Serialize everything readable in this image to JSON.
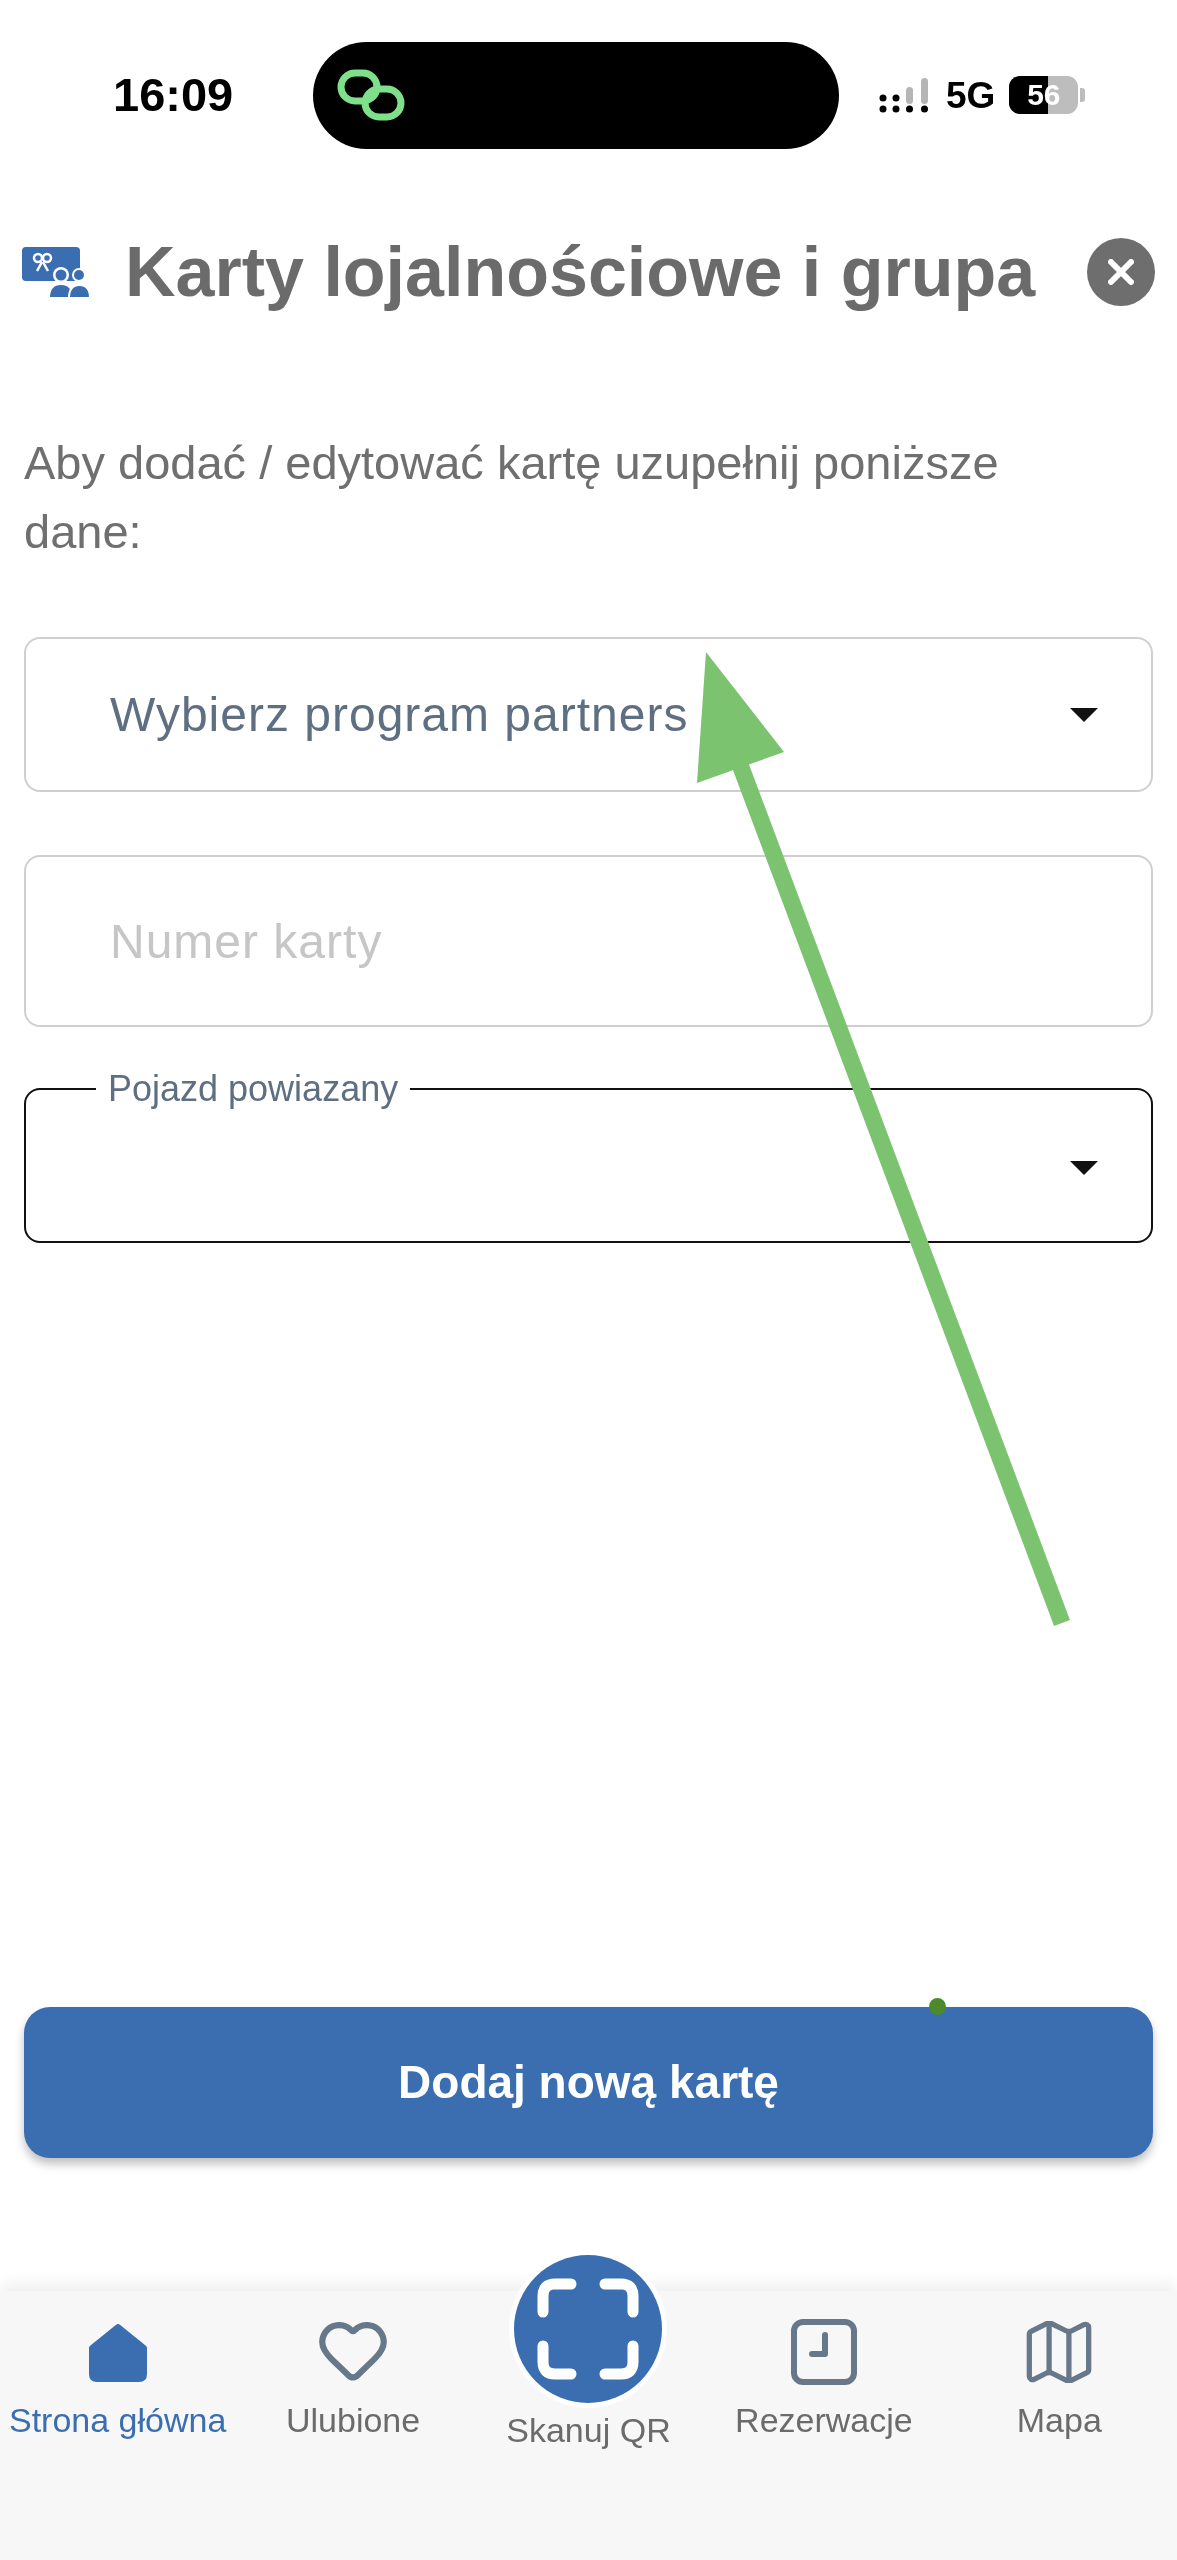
{
  "status_bar": {
    "time": "16:09",
    "network": "5G",
    "battery": "56"
  },
  "header": {
    "title": "Karty lojalnościowe i grupa"
  },
  "intro": "Aby dodać / edytować kartę uzupełnij poniższe dane:",
  "form": {
    "fields": [
      {
        "kind": "select",
        "placeholder": "Wybierz program partners"
      },
      {
        "kind": "input",
        "placeholder": "Numer karty"
      },
      {
        "kind": "select",
        "label": "Pojazd powiazany"
      }
    ]
  },
  "submit_button": "Dodaj nową kartę",
  "bottom_nav": [
    {
      "kind": "tab",
      "label": "Strona główna",
      "selected": true
    },
    {
      "kind": "tab",
      "label": "Ulubione",
      "selected": false
    },
    {
      "kind": "scan",
      "label": "Skanuj QR",
      "selected": false
    },
    {
      "kind": "tab",
      "label": "Rezerwacje",
      "selected": false
    },
    {
      "kind": "tab",
      "label": "Mapa",
      "selected": false
    }
  ]
}
